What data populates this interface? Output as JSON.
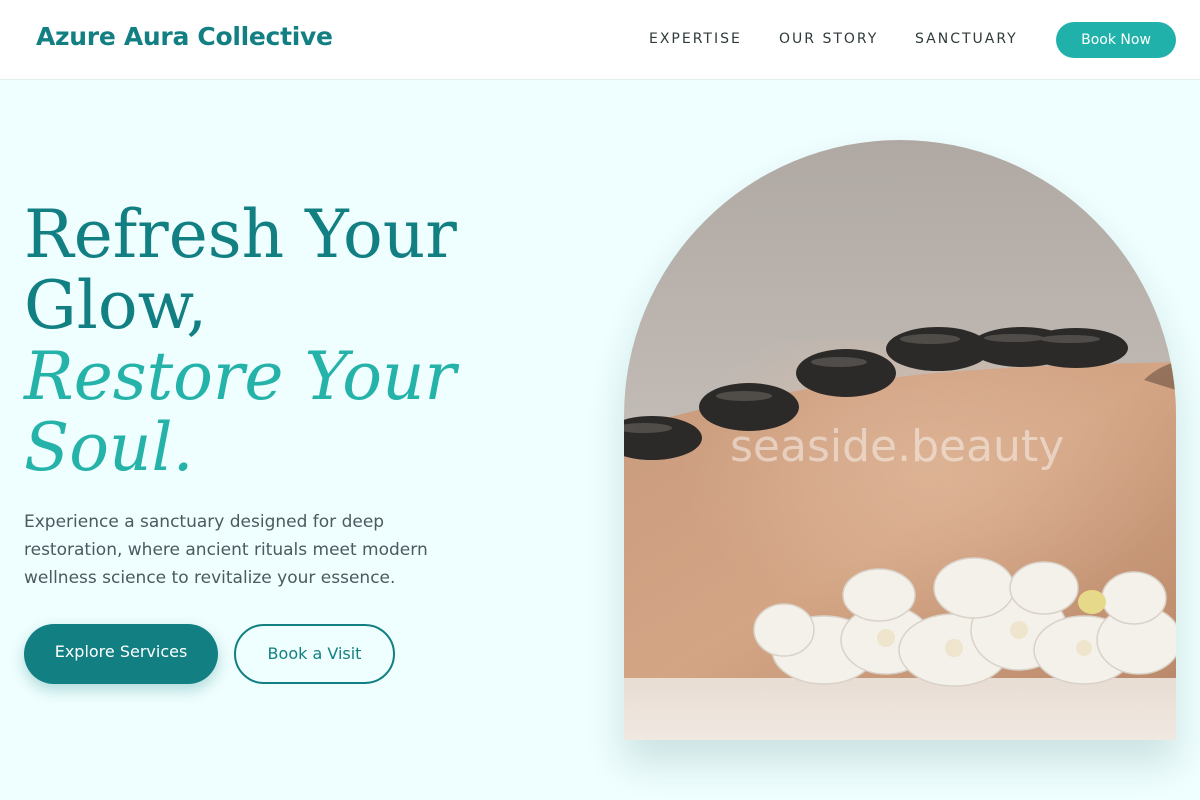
{
  "brand": {
    "name": "Azure Aura Collective"
  },
  "nav": {
    "items": [
      "EXPERTISE",
      "OUR STORY",
      "SANCTUARY"
    ],
    "cta": "Book Now"
  },
  "hero": {
    "headline_lines": [
      "Refresh Your",
      "Glow,"
    ],
    "headline_italic_lines": [
      "Restore Your",
      "Soul."
    ],
    "description": "Experience a sanctuary designed for deep restoration, where ancient rituals meet modern wellness science to revitalize your essence.",
    "primary_button": "Explore Services",
    "secondary_button": "Book a Visit",
    "image_watermark": "seaside.beauty"
  },
  "colors": {
    "primary": "#127f82",
    "accent": "#25b3a9",
    "button": "#20b2aa",
    "background": "#effefe"
  }
}
